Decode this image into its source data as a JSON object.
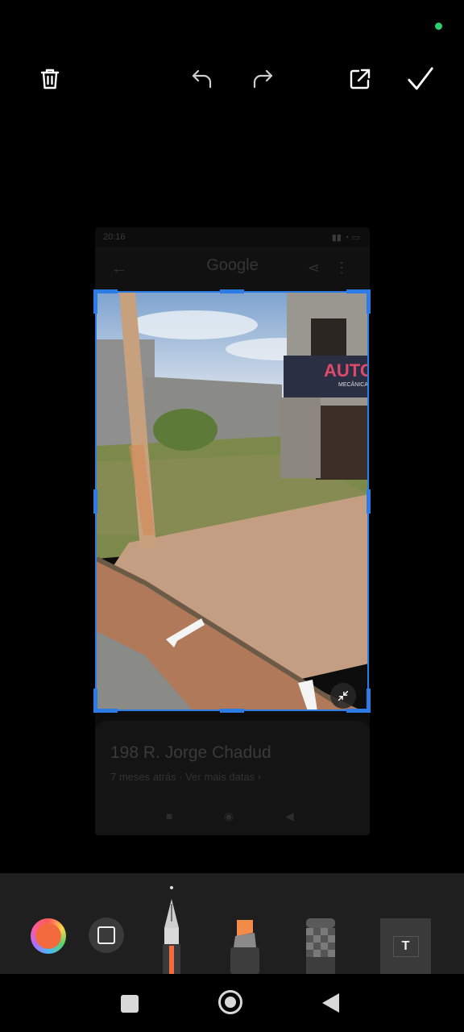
{
  "editor": {
    "top_bar": {
      "delete": "trash-icon",
      "undo": "undo-icon",
      "redo": "redo-icon",
      "export": "external-link-icon",
      "confirm": "check-icon"
    },
    "accent_color": "#2d7be5",
    "indicator_color": "#2ecc71"
  },
  "background_screenshot": {
    "status_time": "20:16",
    "app_title": "Google",
    "address": "198 R. Jorge Chadud",
    "date_line": "7 meses atrás · Ver mais datas ›"
  },
  "photo": {
    "sign_text": "AUTO",
    "sign_subtext": "MECÂNICA"
  },
  "tools": {
    "items": [
      "color-picker",
      "shape-tool",
      "pen-tool",
      "highlighter-tool",
      "mosaic-tool",
      "text-tool"
    ],
    "text_tool_label": "T",
    "selected_color": "#f26a3d"
  },
  "system_nav": [
    "recents-button",
    "home-button",
    "back-button"
  ]
}
